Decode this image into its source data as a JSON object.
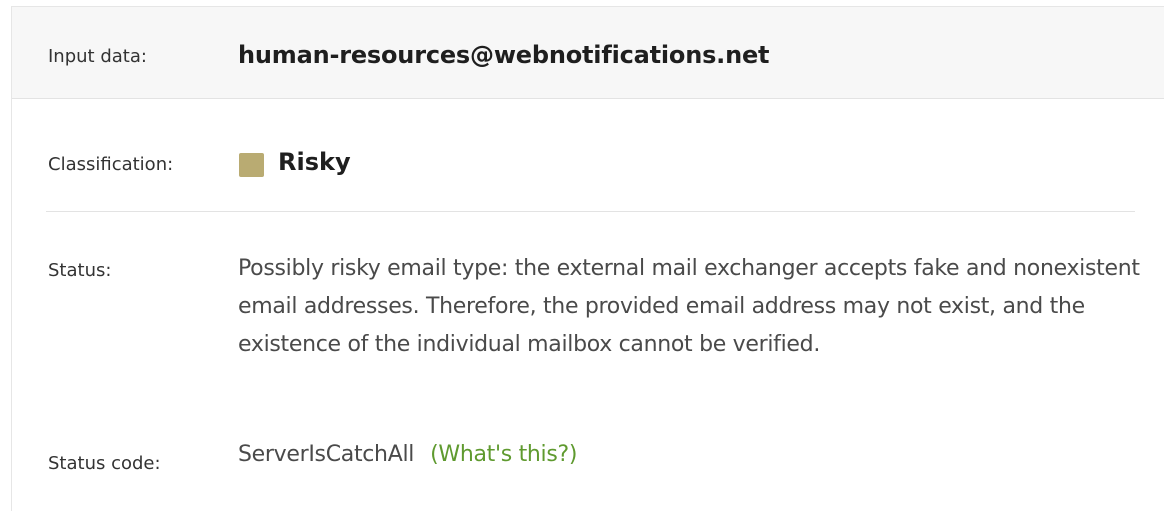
{
  "result": {
    "input": {
      "label": "Input data:",
      "value": "human-resources@webnotifications.net"
    },
    "classification": {
      "label": "Classification:",
      "value": "Risky",
      "swatch_color": "#b9ab72"
    },
    "status": {
      "label": "Status:",
      "text": "Possibly risky email type: the external mail exchanger accepts fake and nonexistent email addresses. Therefore, the provided email address may not exist, and the existence of the individual mailbox cannot be verified."
    },
    "status_code": {
      "label": "Status code:",
      "value": "ServerIsCatchAll",
      "help_link": "(What's this?)",
      "link_color": "#5f9a2f"
    }
  }
}
